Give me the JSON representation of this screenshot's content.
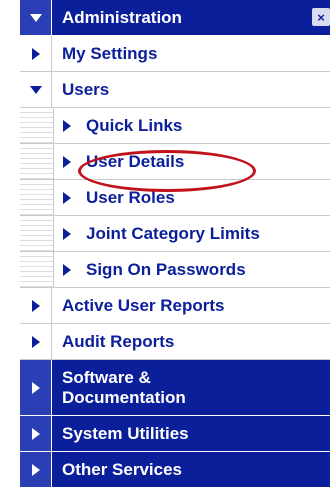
{
  "nav": {
    "administration": {
      "label": "Administration",
      "close_icon": "×"
    },
    "items": {
      "my_settings": "My Settings",
      "users": "Users",
      "quick_links": "Quick Links",
      "user_details": "User Details",
      "user_roles": "User Roles",
      "joint_category_limits": "Joint Category Limits",
      "sign_on_passwords": "Sign On Passwords",
      "active_user_reports": "Active User Reports",
      "audit_reports": "Audit Reports",
      "software_documentation_line1": "Software &",
      "software_documentation_line2": "Documentation",
      "system_utilities": "System Utilities",
      "other_services": "Other Services"
    }
  },
  "colors": {
    "nav_blue": "#0b1f9a",
    "highlight_red": "#c1121c"
  }
}
